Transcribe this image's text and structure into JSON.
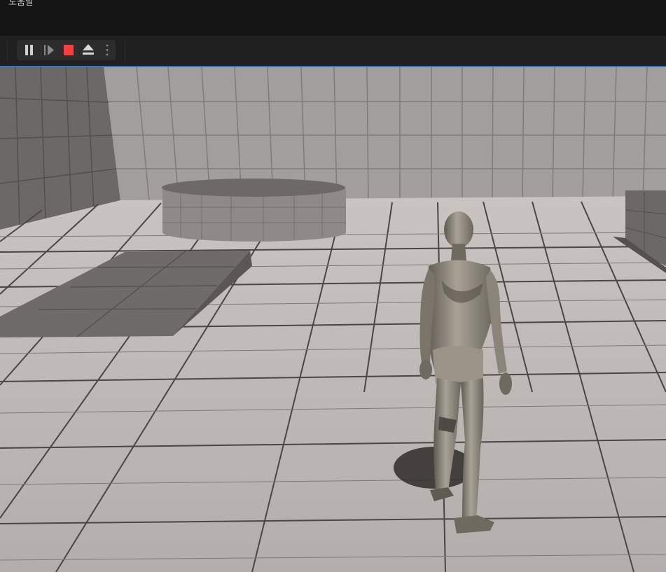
{
  "menubar": {
    "help_label": "도움말"
  },
  "toolbar": {
    "buttons": [
      {
        "name": "pause-button",
        "icon": "pause-icon"
      },
      {
        "name": "frame-skip-button",
        "icon": "step-forward-icon"
      },
      {
        "name": "stop-button",
        "icon": "stop-icon"
      },
      {
        "name": "eject-button",
        "icon": "eject-icon"
      },
      {
        "name": "more-options-button",
        "icon": "vertical-dots-icon"
      }
    ],
    "stop_color": "#ff3b3b"
  },
  "viewport": {
    "accent_border_color": "#2f77c8",
    "floor_color": "#b8b3b2",
    "wall_color": "#9c9897",
    "character_color": "#8d877c"
  }
}
